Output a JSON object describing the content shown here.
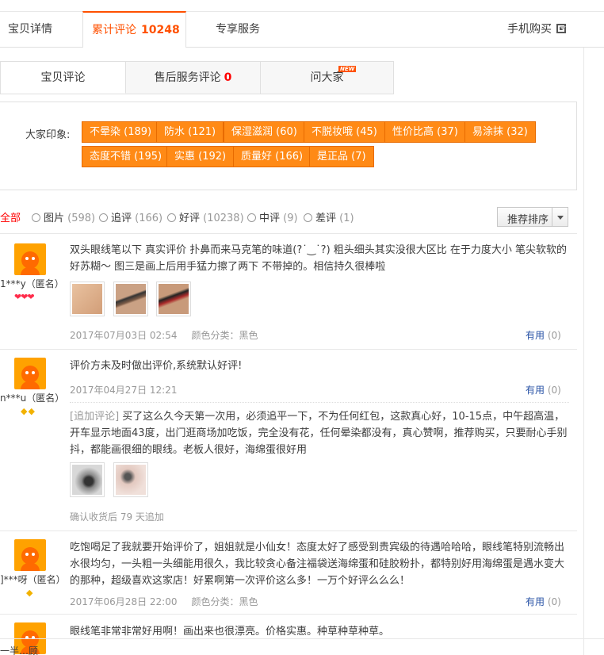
{
  "top_tabs": {
    "details": "宝贝详情",
    "reviews_label": "累计评论",
    "reviews_count": "10248",
    "service": "专享服务",
    "mobile_buy": "手机购买"
  },
  "sub_tabs": {
    "item_reviews": "宝贝评论",
    "after_sale_label": "售后服务评论",
    "after_sale_count": "0",
    "ask": "问大家",
    "new_badge": "NEW"
  },
  "impressions": {
    "label": "大家印象:",
    "tags": [
      "不晕染 (189)",
      "防水 (121)",
      "保湿滋润 (60)",
      "不脱妆哦 (45)",
      "性价比高 (37)",
      "易涂抹 (32)",
      "态度不错 (195)",
      "实惠 (192)",
      "质量好 (166)",
      "是正品 (7)"
    ]
  },
  "filters": [
    {
      "label": "全部",
      "count": ""
    },
    {
      "label": "图片",
      "count": "(598)"
    },
    {
      "label": "追评",
      "count": "(166)"
    },
    {
      "label": "好评",
      "count": "(10238)"
    },
    {
      "label": "中评",
      "count": "(9)"
    },
    {
      "label": "差评",
      "count": "(1)"
    }
  ],
  "sort": {
    "label": "推荐排序"
  },
  "reviews": [
    {
      "user": "1***y（匿名）",
      "level_icons": "❤❤❤",
      "content": "双头眼线笔以下 真实评价 扑鼻而来马克笔的味道(?˙‿˙?) 粗头细头其实没很大区比 在于力度大小 笔尖软软的好苏糊～ 图三是画上后用手猛力擦了两下 不带掉的。相信持久很棒啦",
      "date": "2017年07月03日 02:54",
      "sku": "颜色分类：黑色",
      "useful_label": "有用",
      "useful_count": "(0)"
    },
    {
      "user": "n***u（匿名）",
      "level_icons": "◆◆",
      "content": "评价方未及时做出评价,系统默认好评!",
      "date": "2017年04月27日 12:21",
      "useful_label": "有用",
      "useful_count": "(0)",
      "append_tag": "[追加评论]",
      "append_content": " 买了这么久今天第一次用，必须追平一下，不为任何红包，这款真心好，10-15点，中午超高温，开车显示地面43度，出门逛商场加吃饭，完全没有花，任何晕染都没有，真心赞啊，推荐购买，只要耐心手别抖，都能画很细的眼线。老板人很好，海绵蛋很好用",
      "append_meta": "确认收货后 79 天追加"
    },
    {
      "user": "]***呀（匿名）",
      "level_icons": "◆",
      "content": "吃饱喝足了我就要开始评价了，姐姐就是小仙女！态度太好了感受到贵宾级的待遇哈哈哈，眼线笔特别流畅出水很均匀，一头粗一头细能用很久，我比较贪心备注福袋送海绵蛋和硅胶粉扑，都特别好用海绵蛋是遇水变大的那种，超级喜欢这家店！好累啊第一次评价这么多！一万个好评么么么！",
      "date": "2017年06月28日 22:00",
      "sku": "颜色分类：黑色",
      "useful_label": "有用",
      "useful_count": "(0)"
    },
    {
      "content": "眼线笔非常非常好用啊！画出来也很漂亮。价格实惠。种草种草种草。"
    }
  ],
  "bottom_text": "一半…顾"
}
